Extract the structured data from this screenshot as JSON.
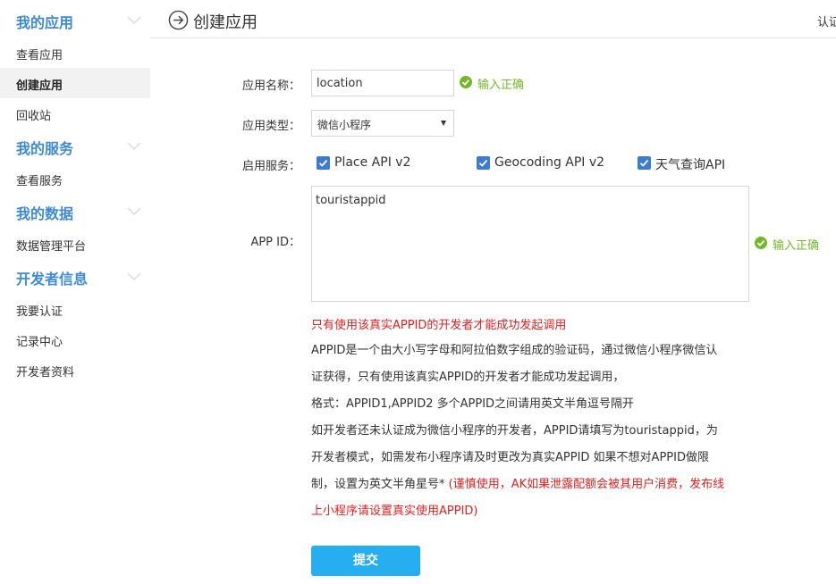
{
  "colors": {
    "accent": "#3d8ad5",
    "success": "#74b72b",
    "error": "#e02020",
    "button": "#27aef0",
    "checkbox": "#3d7ad3"
  },
  "sidebar": {
    "sections": [
      {
        "title": "我的应用",
        "icon": "chevron-down-icon",
        "items": [
          {
            "label": "查看应用",
            "active": false
          },
          {
            "label": "创建应用",
            "active": true
          },
          {
            "label": "回收站",
            "active": false
          }
        ]
      },
      {
        "title": "我的服务",
        "icon": "chevron-down-icon",
        "items": [
          {
            "label": "查看服务",
            "active": false
          }
        ]
      },
      {
        "title": "我的数据",
        "icon": "chevron-down-icon",
        "items": [
          {
            "label": "数据管理平台",
            "active": false
          }
        ]
      },
      {
        "title": "开发者信息",
        "icon": "chevron-down-icon",
        "items": [
          {
            "label": "我要认证",
            "active": false
          },
          {
            "label": "记录中心",
            "active": false
          },
          {
            "label": "开发者资料",
            "active": false
          }
        ]
      }
    ]
  },
  "header": {
    "title": "创建应用",
    "back_icon": "arrow-circle-right-icon",
    "right_link": "认证"
  },
  "form": {
    "name": {
      "label": "应用名称：",
      "value": "location",
      "status": "输入正确"
    },
    "type": {
      "label": "应用类型：",
      "value": "微信小程序"
    },
    "services": {
      "label": "启用服务：",
      "options": [
        {
          "label": "Place API v2",
          "checked": true
        },
        {
          "label": "Geocoding API v2",
          "checked": true
        },
        {
          "label": "天气查询API",
          "checked": true
        }
      ]
    },
    "appid": {
      "label": "APP ID：",
      "value": "touristappid",
      "status": "输入正确"
    },
    "warning": "只有使用该真实APPID的开发者才能成功发起调用",
    "description": {
      "line1": "APPID是一个由大小写字母和阿拉伯数字组成的验证码，通过微信小程序微信认",
      "line2": "证获得，只有使用该真实APPID的开发者才能成功发起调用，",
      "line3": "格式：APPID1,APPID2 多个APPID之间请用英文半角逗号隔开",
      "line4": "如开发者还未认证成为微信小程序的开发者，APPID请填写为touristappid，为",
      "line5": "开发者模式，如需发布小程序请及时更改为真实APPID 如果不想对APPID做限",
      "line6_black": "制，设置为英文半角星号* ",
      "line6_red": "(谨慎使用，AK如果泄露配额会被其用户消费，发布线",
      "line7_red": "上小程序请设置真实使用APPID)"
    },
    "submit_label": "提交"
  }
}
